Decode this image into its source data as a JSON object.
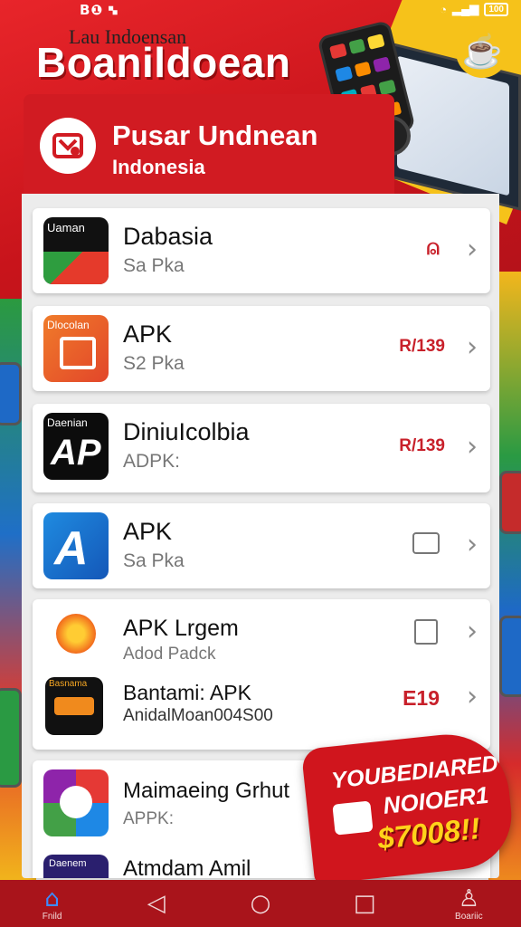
{
  "status_bar": {
    "left": "B❶ 🙿",
    "battery": "100"
  },
  "header": {
    "subtitle_top": "Lau Indoensan",
    "big_title": "Boanildoean",
    "brand_name": "Pusar Undnean",
    "brand_sub": "Indonesia"
  },
  "items": [
    {
      "icon_text": "Uaman",
      "title": "Dabasia",
      "subtitle": "Sa Pka",
      "tag": "",
      "tag_icon": "person-icon"
    },
    {
      "icon_text": "Dlocolan",
      "title": "APK",
      "subtitle": "S2 Pka",
      "tag": "R/139",
      "tag_icon": ""
    },
    {
      "icon_text": "Daenian",
      "title": "DiniuIcolbia",
      "subtitle": "ADPK:",
      "tag": "R/139",
      "tag_icon": ""
    },
    {
      "icon_text": "",
      "title": "APK",
      "subtitle": "Sa Pka",
      "tag": "",
      "tag_icon": "card-icon"
    },
    {
      "icon_text": "",
      "title": "APK Lrgem",
      "subtitle": "Adod Padck",
      "tag": "",
      "tag_icon": "calendar-icon"
    },
    {
      "icon_text": "Basnama",
      "title": "Bantami: APK",
      "subtitle": "AnidalMoan004S00",
      "tag": "E19",
      "tag_icon": ""
    },
    {
      "icon_text": "",
      "title": "Maimaeing Grhut",
      "subtitle": "APPK:",
      "tag": "",
      "tag_icon": ""
    },
    {
      "icon_text": "Daenem",
      "title": "Atmdam Amil",
      "subtitle": "",
      "tag": "",
      "tag_icon": ""
    }
  ],
  "promo": {
    "line1": "YOUBEDIARED",
    "line2": "NOIOER1",
    "line3": "$7008!!"
  },
  "nav": {
    "home_label": "Fnild",
    "profile_label": "Boariic"
  },
  "colors": {
    "brand_red": "#d11b22",
    "accent_yellow": "#f6c21a",
    "nav_bg": "#a9141b"
  }
}
